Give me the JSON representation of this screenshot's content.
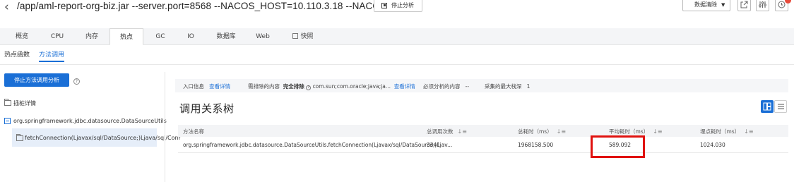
{
  "header": {
    "title": "/app/aml-report-org-biz.jar --server.port=8568 --NACOS_HOST=10.110.3.18 --NACOS_...",
    "stop_label": "停止分析",
    "clear_label": "数据清除"
  },
  "tabs": [
    {
      "label": "概览"
    },
    {
      "label": "CPU"
    },
    {
      "label": "内存"
    },
    {
      "label": "热点"
    },
    {
      "label": "GC"
    },
    {
      "label": "IO"
    },
    {
      "label": "数据库"
    },
    {
      "label": "Web"
    },
    {
      "label": "快照"
    }
  ],
  "subtabs": [
    {
      "label": "热点函数"
    },
    {
      "label": "方法调用"
    }
  ],
  "sidebar": {
    "stop_button": "停止方法调用分析",
    "help": "?",
    "tree_label": "插桩详情",
    "node_class": "org.springframework.jdbc.datasource.DataSourceUtils",
    "node_method": "fetchConnection(Ljavax/sql/DataSource;)Ljava/sql/Conr"
  },
  "info": {
    "entry_label": "入口信息",
    "entry_link": "查看详情",
    "exclude_label": "需排除的内容",
    "exclude_value": "完全排除",
    "exclude_detail": "com.sun;com.oracle;java;ja...",
    "exclude_link": "查看详情",
    "must_label": "必须分析的内容",
    "must_value": "--",
    "depth_label": "采集的最大栈深",
    "depth_value": "1"
  },
  "section_title": "调用关系树",
  "table": {
    "columns": [
      "方法名称",
      "总调用次数",
      "总耗时（ms）",
      "平均耗时（ms）",
      "埋点耗时（ms）"
    ],
    "rows": [
      [
        "org.springframework.jdbc.datasource.DataSourceUtils.fetchConnection(Ljavax/sql/DataSource;)Ljav...",
        "3341",
        "1968158.500",
        "589.092",
        "1024.030"
      ]
    ]
  },
  "colors": {
    "accent": "#1a6fd6",
    "highlight": "#e0120f"
  }
}
